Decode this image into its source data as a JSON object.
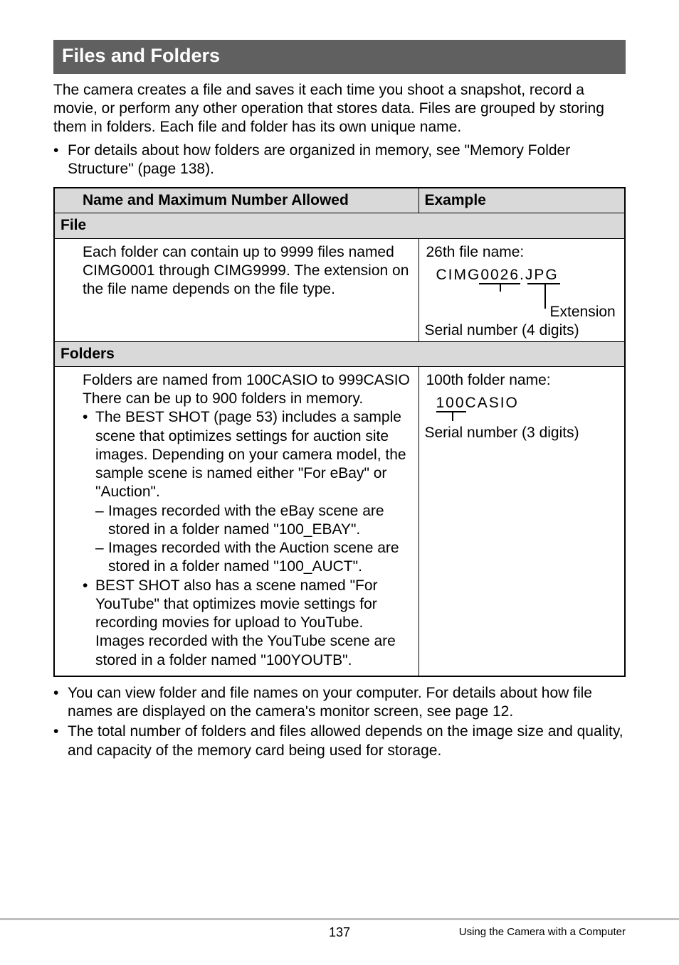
{
  "section": {
    "title": "Files and Folders"
  },
  "intro": "The camera creates a file and saves it each time you shoot a snapshot, record a movie, or perform any other operation that stores data. Files are grouped by storing them in folders. Each file and folder has its own unique name.",
  "intro_bullet": "For details about how folders are organized in memory, see \"Memory Folder Structure\" (page 138).",
  "table": {
    "head_name": "Name and Maximum Number Allowed",
    "head_example": "Example",
    "row_file": "File",
    "file_desc": "Each folder can contain up to 9999 files named CIMG0001 through CIMG9999. The extension on the file name depends on the file type.",
    "file_ex_line": "26th file name:",
    "file_mono": "CIMG0026.JPG",
    "file_ext_label": "Extension",
    "file_serial_label": "Serial number (4 digits)",
    "row_folders": "Folders",
    "folders_p1": "Folders are named from 100CASIO to 999CASIO There can be up to 900 folders in memory.",
    "folders_b1": "The BEST SHOT (page 53) includes a sample scene that optimizes settings for auction site images. Depending on your camera model, the sample scene is named either \"For eBay\" or \"Auction\".",
    "folders_b1a": "Images recorded with the eBay scene are stored in a folder named \"100_EBAY\".",
    "folders_b1b": "Images recorded with the Auction scene are stored in a folder named \"100_AUCT\".",
    "folders_b2": "BEST SHOT also has a scene named \"For YouTube\" that optimizes movie settings for recording movies for upload to YouTube. Images recorded with the YouTube scene are stored in a folder named \"100YOUTB\".",
    "folder_ex_line": "100th folder name:",
    "folder_mono": "100CASIO",
    "folder_serial_label": "Serial number (3 digits)"
  },
  "after": {
    "b1": "You can view folder and file names on your computer. For details about how file names are displayed on the camera's monitor screen, see page 12.",
    "b2": "The total number of folders and files allowed depends on the image size and quality, and capacity of the memory card being used for storage."
  },
  "footer": {
    "page": "137",
    "right": "Using the Camera with a Computer"
  }
}
